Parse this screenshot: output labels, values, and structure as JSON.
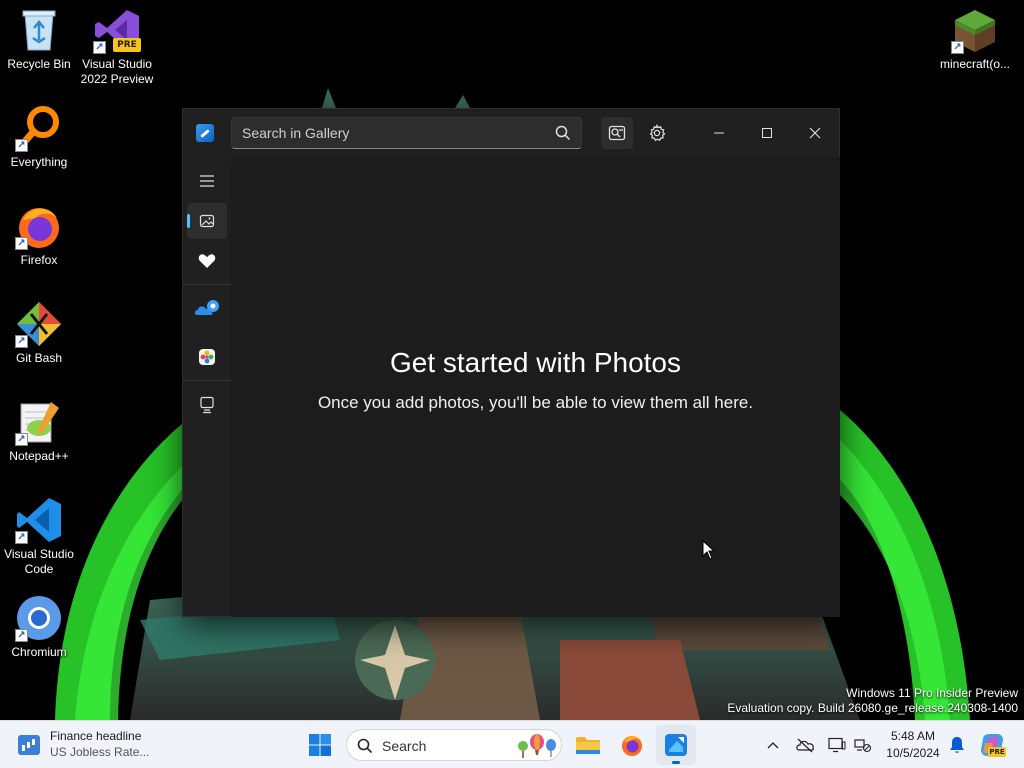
{
  "desktop": {
    "icons": [
      {
        "label": "Recycle Bin"
      },
      {
        "label": "Visual Studio 2022 Preview",
        "badge": "PRE"
      },
      {
        "label": "Everything"
      },
      {
        "label": "Firefox"
      },
      {
        "label": "Git Bash"
      },
      {
        "label": "Notepad++"
      },
      {
        "label": "Visual Studio Code"
      },
      {
        "label": "Chromium"
      },
      {
        "label": "minecraft(o..."
      }
    ],
    "watermark": {
      "line1": "Windows 11 Pro Insider Preview",
      "line2": "Evaluation copy. Build 26080.ge_release.240308-1400"
    }
  },
  "photos_window": {
    "search_placeholder": "Search in Gallery",
    "nav_items": [
      {
        "name": "menu-icon"
      },
      {
        "name": "gallery-icon",
        "selected": true
      },
      {
        "name": "favorites-heart-icon"
      },
      {
        "name": "onedrive-icon"
      },
      {
        "name": "icloud-photos-icon"
      },
      {
        "name": "this-pc-icon"
      }
    ],
    "empty_state": {
      "title": "Get started with Photos",
      "subtitle": "Once you add photos, you'll be able to view them all here."
    }
  },
  "taskbar": {
    "widget": {
      "headline": "Finance headline",
      "subtext": "US Jobless Rate..."
    },
    "search_label": "Search",
    "apps": [
      "start-icon",
      "file-explorer-icon",
      "firefox-icon",
      "photos-icon"
    ],
    "clock": {
      "time": "5:48 AM",
      "date": "10/5/2024"
    },
    "tray_icons": [
      "show-hidden-icons-chevron",
      "onedrive-offline-icon",
      "display-icon",
      "network-icon",
      "notification-bell-icon",
      "copilot-icon"
    ],
    "copilot_badge": "PRE"
  },
  "colors": {
    "accent": "#4cc2ff",
    "window_bg": "#202020",
    "content_bg": "#1c1c1c",
    "taskbar_bg": "#f0f3f9",
    "wallpaper_green": "#2ee62e"
  }
}
